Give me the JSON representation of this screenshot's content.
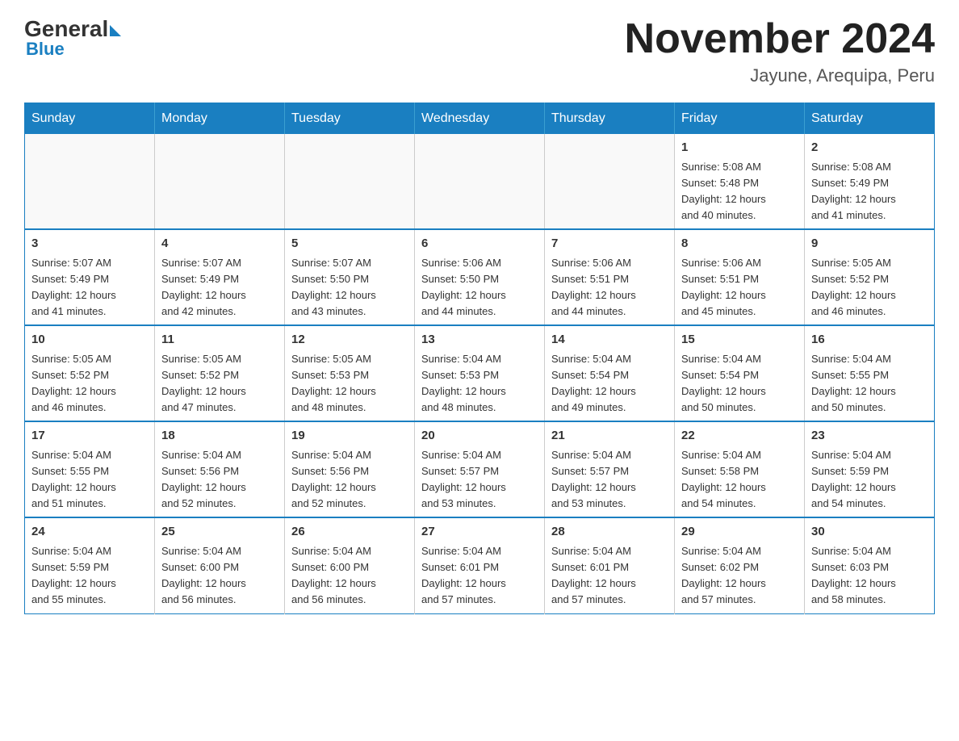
{
  "header": {
    "logo": {
      "general": "General",
      "blue": "Blue"
    },
    "title": "November 2024",
    "location": "Jayune, Arequipa, Peru"
  },
  "weekdays": [
    "Sunday",
    "Monday",
    "Tuesday",
    "Wednesday",
    "Thursday",
    "Friday",
    "Saturday"
  ],
  "weeks": [
    [
      {
        "day": "",
        "info": ""
      },
      {
        "day": "",
        "info": ""
      },
      {
        "day": "",
        "info": ""
      },
      {
        "day": "",
        "info": ""
      },
      {
        "day": "",
        "info": ""
      },
      {
        "day": "1",
        "info": "Sunrise: 5:08 AM\nSunset: 5:48 PM\nDaylight: 12 hours\nand 40 minutes."
      },
      {
        "day": "2",
        "info": "Sunrise: 5:08 AM\nSunset: 5:49 PM\nDaylight: 12 hours\nand 41 minutes."
      }
    ],
    [
      {
        "day": "3",
        "info": "Sunrise: 5:07 AM\nSunset: 5:49 PM\nDaylight: 12 hours\nand 41 minutes."
      },
      {
        "day": "4",
        "info": "Sunrise: 5:07 AM\nSunset: 5:49 PM\nDaylight: 12 hours\nand 42 minutes."
      },
      {
        "day": "5",
        "info": "Sunrise: 5:07 AM\nSunset: 5:50 PM\nDaylight: 12 hours\nand 43 minutes."
      },
      {
        "day": "6",
        "info": "Sunrise: 5:06 AM\nSunset: 5:50 PM\nDaylight: 12 hours\nand 44 minutes."
      },
      {
        "day": "7",
        "info": "Sunrise: 5:06 AM\nSunset: 5:51 PM\nDaylight: 12 hours\nand 44 minutes."
      },
      {
        "day": "8",
        "info": "Sunrise: 5:06 AM\nSunset: 5:51 PM\nDaylight: 12 hours\nand 45 minutes."
      },
      {
        "day": "9",
        "info": "Sunrise: 5:05 AM\nSunset: 5:52 PM\nDaylight: 12 hours\nand 46 minutes."
      }
    ],
    [
      {
        "day": "10",
        "info": "Sunrise: 5:05 AM\nSunset: 5:52 PM\nDaylight: 12 hours\nand 46 minutes."
      },
      {
        "day": "11",
        "info": "Sunrise: 5:05 AM\nSunset: 5:52 PM\nDaylight: 12 hours\nand 47 minutes."
      },
      {
        "day": "12",
        "info": "Sunrise: 5:05 AM\nSunset: 5:53 PM\nDaylight: 12 hours\nand 48 minutes."
      },
      {
        "day": "13",
        "info": "Sunrise: 5:04 AM\nSunset: 5:53 PM\nDaylight: 12 hours\nand 48 minutes."
      },
      {
        "day": "14",
        "info": "Sunrise: 5:04 AM\nSunset: 5:54 PM\nDaylight: 12 hours\nand 49 minutes."
      },
      {
        "day": "15",
        "info": "Sunrise: 5:04 AM\nSunset: 5:54 PM\nDaylight: 12 hours\nand 50 minutes."
      },
      {
        "day": "16",
        "info": "Sunrise: 5:04 AM\nSunset: 5:55 PM\nDaylight: 12 hours\nand 50 minutes."
      }
    ],
    [
      {
        "day": "17",
        "info": "Sunrise: 5:04 AM\nSunset: 5:55 PM\nDaylight: 12 hours\nand 51 minutes."
      },
      {
        "day": "18",
        "info": "Sunrise: 5:04 AM\nSunset: 5:56 PM\nDaylight: 12 hours\nand 52 minutes."
      },
      {
        "day": "19",
        "info": "Sunrise: 5:04 AM\nSunset: 5:56 PM\nDaylight: 12 hours\nand 52 minutes."
      },
      {
        "day": "20",
        "info": "Sunrise: 5:04 AM\nSunset: 5:57 PM\nDaylight: 12 hours\nand 53 minutes."
      },
      {
        "day": "21",
        "info": "Sunrise: 5:04 AM\nSunset: 5:57 PM\nDaylight: 12 hours\nand 53 minutes."
      },
      {
        "day": "22",
        "info": "Sunrise: 5:04 AM\nSunset: 5:58 PM\nDaylight: 12 hours\nand 54 minutes."
      },
      {
        "day": "23",
        "info": "Sunrise: 5:04 AM\nSunset: 5:59 PM\nDaylight: 12 hours\nand 54 minutes."
      }
    ],
    [
      {
        "day": "24",
        "info": "Sunrise: 5:04 AM\nSunset: 5:59 PM\nDaylight: 12 hours\nand 55 minutes."
      },
      {
        "day": "25",
        "info": "Sunrise: 5:04 AM\nSunset: 6:00 PM\nDaylight: 12 hours\nand 56 minutes."
      },
      {
        "day": "26",
        "info": "Sunrise: 5:04 AM\nSunset: 6:00 PM\nDaylight: 12 hours\nand 56 minutes."
      },
      {
        "day": "27",
        "info": "Sunrise: 5:04 AM\nSunset: 6:01 PM\nDaylight: 12 hours\nand 57 minutes."
      },
      {
        "day": "28",
        "info": "Sunrise: 5:04 AM\nSunset: 6:01 PM\nDaylight: 12 hours\nand 57 minutes."
      },
      {
        "day": "29",
        "info": "Sunrise: 5:04 AM\nSunset: 6:02 PM\nDaylight: 12 hours\nand 57 minutes."
      },
      {
        "day": "30",
        "info": "Sunrise: 5:04 AM\nSunset: 6:03 PM\nDaylight: 12 hours\nand 58 minutes."
      }
    ]
  ]
}
